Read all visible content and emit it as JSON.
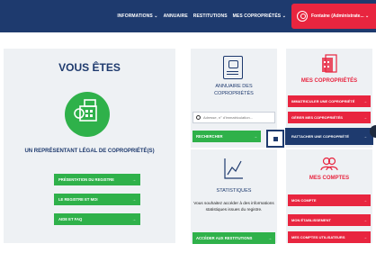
{
  "topbar": {
    "nav": [
      "INFORMATIONS ⌄",
      "ANNUAIRE",
      "RESTITUTIONS",
      "MES COPROPRIÉTÉS ⌄"
    ],
    "user_label": "Fontaine (Administrate... ⌄"
  },
  "left": {
    "title": "VOUS ÊTES",
    "subtitle": "UN REPRÉSENTANT LÉGAL DE COPROPRIÉTÉ(S)",
    "buttons": [
      "PRÉSENTATION DU REGISTRE",
      "LE REGISTRE ET MOI",
      "AIDE ET FAQ"
    ]
  },
  "annuaire": {
    "title_line1": "ANNUAIRE DES",
    "title_line2": "COPROPRIÉTÉS",
    "search_placeholder": "Adresse, n° d'immatriculation...",
    "search_button": "RECHERCHER"
  },
  "stats": {
    "title": "STATISTIQUES",
    "description": "Vous souhaitez accéder à des informations statistiques issues du registre.",
    "button": "ACCÉDER AUX RESTITUTIONS"
  },
  "copros": {
    "title": "MES COPROPRIÉTÉS",
    "buttons": [
      "IMMATRICULER UNE COPROPRIÉTÉ",
      "GÉRER MES COPROPRIÉTÉS",
      "RATTACHER UNE COPROPRIÉTÉ"
    ]
  },
  "comptes": {
    "title": "MES COMPTES",
    "buttons": [
      "MON COMPTE",
      "MON ÉTABLISSEMENT",
      "MES COMPTES UTILISATEURS"
    ]
  },
  "arrow": "→",
  "colors": {
    "navy": "#1e3a6e",
    "green": "#2fb14a",
    "red": "#e8253f"
  }
}
